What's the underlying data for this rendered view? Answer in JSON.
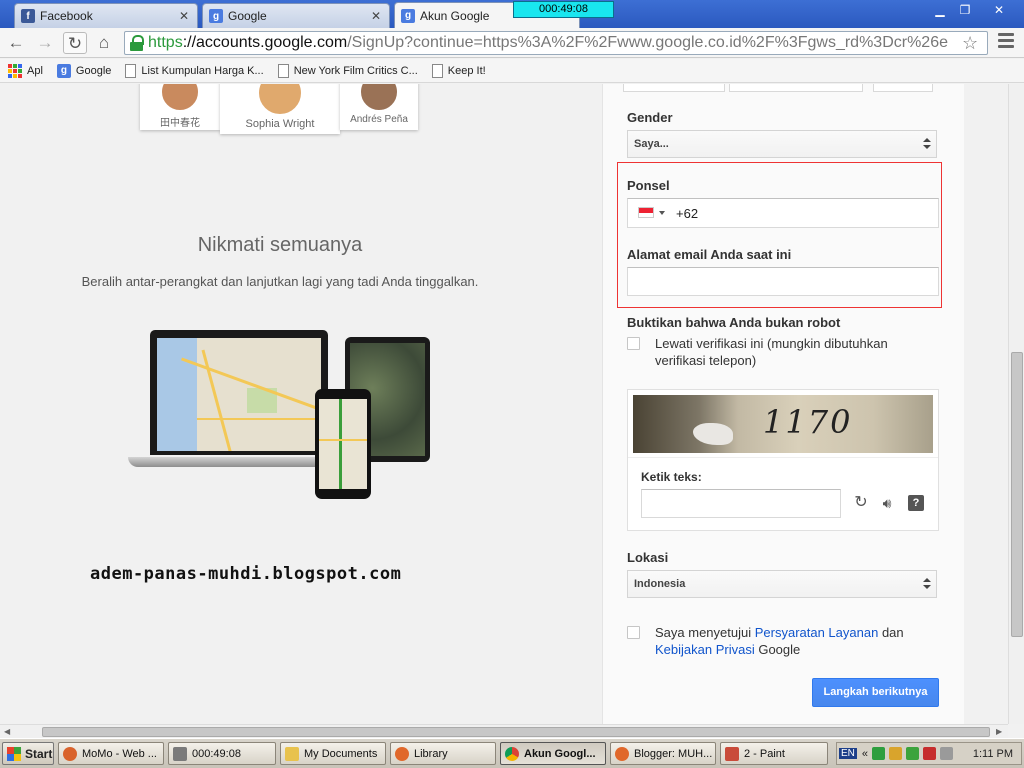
{
  "browser": {
    "tabs": [
      {
        "label": "Facebook",
        "icon": "facebook-icon",
        "active": false
      },
      {
        "label": "Google",
        "icon": "google-icon",
        "active": false
      },
      {
        "label": "Akun Google",
        "icon": "google-icon",
        "active": true
      }
    ],
    "timer_overlay": "000:49:08",
    "url": {
      "scheme": "https",
      "host": "://accounts.google.com",
      "path": "/SignUp?continue=https%3A%2F%2Fwww.google.co.id%2F%3Fgws_rd%3Dcr%26e"
    },
    "bookmarks": [
      {
        "label": "Apl",
        "icon": "apps-icon"
      },
      {
        "label": "Google",
        "icon": "google-icon"
      },
      {
        "label": "List Kumpulan Harga K...",
        "icon": "page-icon"
      },
      {
        "label": "New York Film Critics C...",
        "icon": "page-icon"
      },
      {
        "label": "Keep It!",
        "icon": "page-icon"
      }
    ]
  },
  "left": {
    "avatars": [
      {
        "name": "田中春花",
        "color": "#c98a5e"
      },
      {
        "name": "Sophia Wright",
        "color": "#e0a96d"
      },
      {
        "name": "Andrés Peña",
        "color": "#9a7256"
      }
    ],
    "headline": "Nikmati semuanya",
    "subtext": "Beralih antar-perangkat dan lanjutkan lagi yang tadi Anda tinggalkan.",
    "watermark": "adem-panas-muhdi.blogspot.com"
  },
  "form": {
    "gender_label": "Gender",
    "gender_value": "Saya...",
    "phone_label": "Ponsel",
    "phone_value": "+62",
    "email_label": "Alamat email Anda saat ini",
    "email_value": "",
    "robot_label": "Buktikan bahwa Anda bukan robot",
    "skip_verification": "Lewati verifikasi ini (mungkin dibutuhkan verifikasi telepon)",
    "captcha_text": "1170",
    "captcha_input_label": "Ketik teks:",
    "captcha_input_value": "",
    "location_label": "Lokasi",
    "location_value": "Indonesia",
    "terms_prefix": "Saya menyetujui ",
    "terms_link": "Persyaratan Layanan",
    "terms_and": " dan",
    "privacy_link": "Kebijakan Privasi",
    "terms_suffix": " Google",
    "next_button": "Langkah berikutnya"
  },
  "taskbar": {
    "start_label": "Start",
    "tasks": [
      {
        "label": "MoMo - Web ...",
        "icon_color": "#d9632c",
        "active": false
      },
      {
        "label": "000:49:08",
        "icon_color": "#7a7a7a",
        "active": false
      },
      {
        "label": "My Documents",
        "icon_color": "#e8c24d",
        "active": false
      },
      {
        "label": "Library",
        "icon_color": "#e0682b",
        "active": false
      },
      {
        "label": "Akun Googl...",
        "icon_color": "#3aa757",
        "active": true
      },
      {
        "label": "Blogger: MUH...",
        "icon_color": "#e0682b",
        "active": false
      },
      {
        "label": "2 - Paint",
        "icon_color": "#c94b3a",
        "active": false
      }
    ],
    "tray_lang": "EN",
    "tray_chevron": "«",
    "clock": "1:11 PM"
  },
  "colors": {
    "accent": "#4d90fe",
    "link": "#1155cc",
    "highlight": "#ee3333",
    "secure": "#2b9a3c"
  }
}
